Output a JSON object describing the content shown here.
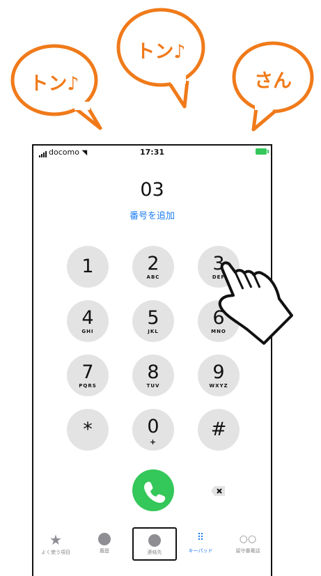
{
  "bubbles": [
    {
      "text": "トン♪"
    },
    {
      "text": "トン♪"
    },
    {
      "text": "さん"
    }
  ],
  "status_bar": {
    "carrier": "docomo",
    "time": "17:31"
  },
  "dialer": {
    "number": "03",
    "add_number": "番号を追加",
    "keys": [
      {
        "digit": "1",
        "letters": ""
      },
      {
        "digit": "2",
        "letters": "ABC"
      },
      {
        "digit": "3",
        "letters": "DEF"
      },
      {
        "digit": "4",
        "letters": "GHI"
      },
      {
        "digit": "5",
        "letters": "JKL"
      },
      {
        "digit": "6",
        "letters": "MNO"
      },
      {
        "digit": "7",
        "letters": "PQRS"
      },
      {
        "digit": "8",
        "letters": "TUV"
      },
      {
        "digit": "9",
        "letters": "WXYZ"
      },
      {
        "digit": "*",
        "letters": ""
      },
      {
        "digit": "0",
        "letters": "+"
      },
      {
        "digit": "#",
        "letters": ""
      }
    ]
  },
  "tabbar": {
    "tabs": [
      {
        "label": "よく使う項目"
      },
      {
        "label": "履歴"
      },
      {
        "label": "連絡先"
      },
      {
        "label": "キーパッド"
      },
      {
        "label": "留守番電話"
      }
    ]
  },
  "colors": {
    "accent": "#1b7cf0",
    "call": "#34c759",
    "bubble": "#f07a1a",
    "key": "#e3e3e3"
  }
}
